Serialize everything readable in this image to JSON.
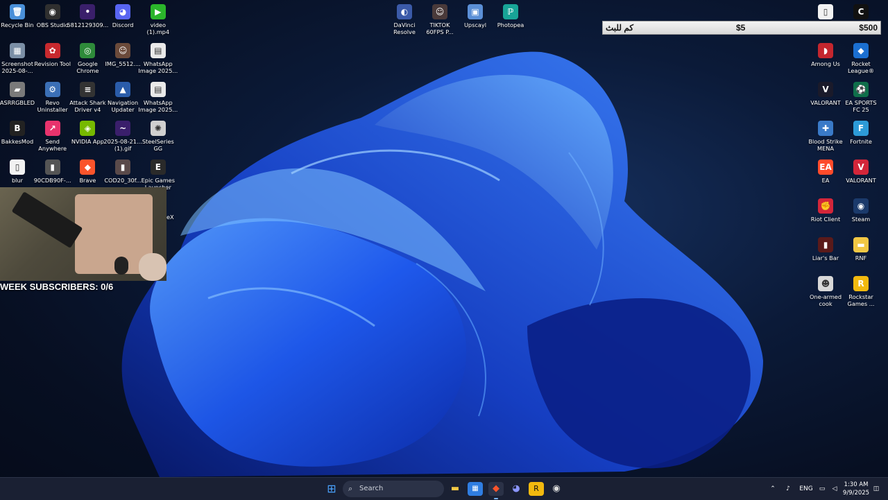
{
  "desktop_icons_left": [
    {
      "label": "Recycle Bin",
      "icon": "recycle-bin-icon",
      "glyph": "🗑",
      "bg": "#4a90d9"
    },
    {
      "label": "OBS Studio",
      "icon": "obs-icon",
      "glyph": "◉",
      "bg": "#2f2f2f"
    },
    {
      "label": "5812129309...",
      "icon": "app-icon",
      "glyph": "•",
      "bg": "#3a1f6b"
    },
    {
      "label": "Discord",
      "icon": "discord-icon",
      "glyph": "◕",
      "bg": "#5865f2"
    },
    {
      "label": "video\n(1).mp4",
      "icon": "video-file-icon",
      "glyph": "▶",
      "bg": "#2bb52b"
    },
    {
      "label": "Screenshot\n2025-08-...",
      "icon": "image-file-icon",
      "glyph": "▦",
      "bg": "#7b8fa6"
    },
    {
      "label": "Revision Tool",
      "icon": "revision-tool-icon",
      "glyph": "✿",
      "bg": "#c8292e"
    },
    {
      "label": "Google\nChrome",
      "icon": "chrome-icon",
      "glyph": "◎",
      "bg": "#2e8b3a"
    },
    {
      "label": "IMG_5512....",
      "icon": "photo-file-icon",
      "glyph": "☺",
      "bg": "#6b4a3a"
    },
    {
      "label": "WhatsApp\nImage 2025...",
      "icon": "image-file-icon",
      "glyph": "▤",
      "bg": "#e9e9e9"
    },
    {
      "label": "ASRRGBLED",
      "icon": "asrock-rgb-icon",
      "glyph": "▰",
      "bg": "#7a7a7a"
    },
    {
      "label": "Revo\nUninstaller",
      "icon": "revo-uninstaller-icon",
      "glyph": "⚙",
      "bg": "#3b6fb6"
    },
    {
      "label": "Attack Shark\nDriver v4",
      "icon": "attack-shark-icon",
      "glyph": "≡",
      "bg": "#333333"
    },
    {
      "label": "Navigation\nUpdater",
      "icon": "navigation-updater-icon",
      "glyph": "▲",
      "bg": "#2a5caa"
    },
    {
      "label": "WhatsApp\nImage 2025...",
      "icon": "image-file-icon",
      "glyph": "▤",
      "bg": "#e9e9e9"
    },
    {
      "label": "BakkesMod",
      "icon": "bakkesmod-icon",
      "glyph": "B",
      "bg": "#222222"
    },
    {
      "label": "Send\nAnywhere",
      "icon": "send-anywhere-icon",
      "glyph": "↗",
      "bg": "#e8336d"
    },
    {
      "label": "NVIDIA App",
      "icon": "nvidia-icon",
      "glyph": "◈",
      "bg": "#76b900"
    },
    {
      "label": "2025-08-21...\n(1).gif",
      "icon": "gif-file-icon",
      "glyph": "~",
      "bg": "#3a1f6b"
    },
    {
      "label": "SteelSeries\nGG",
      "icon": "steelseries-icon",
      "glyph": "✺",
      "bg": "#d0d0d0"
    },
    {
      "label": "blur",
      "icon": "file-icon",
      "glyph": "▯",
      "bg": "#f2f2f2"
    },
    {
      "label": "90CDB90F-...",
      "icon": "image-file-icon",
      "glyph": "▮",
      "bg": "#555555"
    },
    {
      "label": "Brave",
      "icon": "brave-icon",
      "glyph": "◆",
      "bg": "#fb542b"
    },
    {
      "label": "COD20_30f...",
      "icon": "image-file-icon",
      "glyph": "▮",
      "bg": "#5a4a4a"
    },
    {
      "label": "Epic Games\nLauncher",
      "icon": "epic-games-icon",
      "glyph": "E",
      "bg": "#2a2a2a"
    }
  ],
  "desktop_icons_top": [
    {
      "label": "DaVinci\nResolve",
      "icon": "davinci-resolve-icon",
      "glyph": "◐",
      "bg": "#3b5aa8"
    },
    {
      "label": "TIKTOK\n60FPS P...",
      "icon": "video-file-icon",
      "glyph": "☺",
      "bg": "#4a3a3a"
    },
    {
      "label": "Upscayl",
      "icon": "upscayl-icon",
      "glyph": "▣",
      "bg": "#5b8fd6"
    },
    {
      "label": "Photopea",
      "icon": "photopea-icon",
      "glyph": "ℙ",
      "bg": "#18a497"
    }
  ],
  "desktop_icons_right": [
    {
      "label": "",
      "icon": "file-icon",
      "glyph": "▯",
      "bg": "#f2f2f2"
    },
    {
      "label": "",
      "icon": "call-of-duty-icon",
      "glyph": "C",
      "bg": "#111111"
    },
    {
      "label": "Among Us",
      "icon": "among-us-icon",
      "glyph": "◗",
      "bg": "#c4262e"
    },
    {
      "label": "Rocket\nLeague®",
      "icon": "rocket-league-icon",
      "glyph": "◆",
      "bg": "#1b6fd1"
    },
    {
      "label": "VALORANT",
      "icon": "valorant-icon",
      "glyph": "V",
      "bg": "#1a1a2a"
    },
    {
      "label": "EA SPORTS\nFC 25",
      "icon": "ea-sports-fc-icon",
      "glyph": "⚽",
      "bg": "#0f6e4a"
    },
    {
      "label": "Blood Strike\nMENA",
      "icon": "blood-strike-icon",
      "glyph": "✚",
      "bg": "#3a7ac8"
    },
    {
      "label": "Fortnite",
      "icon": "fortnite-icon",
      "glyph": "F",
      "bg": "#2d9bd8"
    },
    {
      "label": "EA",
      "icon": "ea-icon",
      "glyph": "EA",
      "bg": "#ff4b2b"
    },
    {
      "label": "VALORANT",
      "icon": "valorant-icon",
      "glyph": "V",
      "bg": "#d3263a"
    },
    {
      "label": "Riot Client",
      "icon": "riot-client-icon",
      "glyph": "✊",
      "bg": "#d3263a"
    },
    {
      "label": "Steam",
      "icon": "steam-icon",
      "glyph": "◉",
      "bg": "#1b3a6b"
    },
    {
      "label": "Liar's Bar",
      "icon": "liars-bar-icon",
      "glyph": "▮",
      "bg": "#5a1a1a"
    },
    {
      "label": "RNF",
      "icon": "folder-icon",
      "glyph": "▬",
      "bg": "#f2c744"
    },
    {
      "label": "One-armed\ncook",
      "icon": "one-armed-cook-icon",
      "glyph": "☻",
      "bg": "#d8d8d8"
    },
    {
      "label": "Rockstar\nGames ...",
      "icon": "rockstar-games-icon",
      "glyph": "R",
      "bg": "#f2b90f"
    }
  ],
  "webcam_cut_label": "eX",
  "overlay": {
    "subscribers_text": "WEEK SUBSCRIBERS: 0/6",
    "donation_label": "كم للبث",
    "donation_current": "$5",
    "donation_goal": "$500"
  },
  "taskbar": {
    "search_placeholder": "Search",
    "apps": [
      {
        "icon": "windows-start-icon",
        "glyph": "⊞"
      },
      {
        "icon": "file-explorer-icon",
        "glyph": "▬"
      },
      {
        "icon": "microsoft-store-icon",
        "glyph": "▦"
      },
      {
        "icon": "brave-icon",
        "glyph": "◆"
      },
      {
        "icon": "discord-icon",
        "glyph": "◕"
      },
      {
        "icon": "rockstar-games-icon",
        "glyph": "R"
      },
      {
        "icon": "obs-icon",
        "glyph": "◉"
      }
    ],
    "language": "ENG",
    "time": "1:30 AM",
    "date": "9/9/2025"
  }
}
